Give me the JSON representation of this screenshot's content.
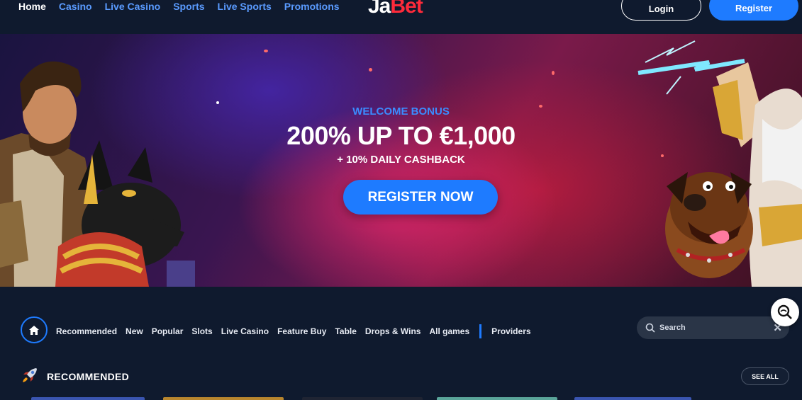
{
  "nav": {
    "items": [
      {
        "label": "Home",
        "active": true
      },
      {
        "label": "Casino",
        "active": false
      },
      {
        "label": "Live Casino",
        "active": false
      },
      {
        "label": "Sports",
        "active": false
      },
      {
        "label": "Live Sports",
        "active": false
      },
      {
        "label": "Promotions",
        "active": false
      }
    ]
  },
  "brand": {
    "logo_part1": "Ja",
    "logo_part2": "Bet"
  },
  "auth": {
    "login_label": "Login",
    "register_label": "Register"
  },
  "hero": {
    "kicker": "WELCOME BONUS",
    "title": "200% UP TO €1,000",
    "subtitle": "+ 10% DAILY CASHBACK",
    "cta_label": "REGISTER NOW"
  },
  "categories": {
    "items": [
      "Recommended",
      "New",
      "Popular",
      "Slots",
      "Live Casino",
      "Feature Buy",
      "Table",
      "Drops & Wins",
      "All games"
    ],
    "providers_label": "Providers"
  },
  "search": {
    "placeholder": "Search"
  },
  "section": {
    "title": "RECOMMENDED",
    "see_all_label": "SEE ALL"
  },
  "colors": {
    "accent": "#1e7bff",
    "background": "#0f1a2e",
    "brand_red": "#ff2a3a",
    "link_blue": "#5a9bff"
  }
}
